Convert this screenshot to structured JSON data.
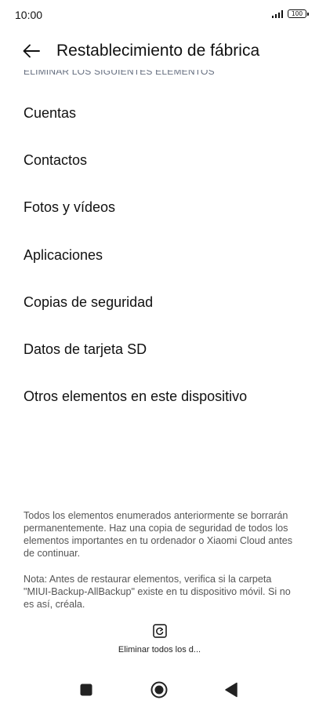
{
  "status_bar": {
    "time": "10:00",
    "battery": "100",
    "icons": [
      "signal-icon",
      "battery-icon"
    ]
  },
  "header": {
    "title": "Restablecimiento de fábrica",
    "back_icon": "arrow-left-icon"
  },
  "section_label": "ELIMINAR LOS SIGUIENTES ELEMENTOS",
  "items": [
    {
      "label": "Cuentas"
    },
    {
      "label": "Contactos"
    },
    {
      "label": "Fotos y vídeos"
    },
    {
      "label": "Aplicaciones"
    },
    {
      "label": "Copias de seguridad"
    },
    {
      "label": "Datos de tarjeta SD"
    },
    {
      "label": "Otros elementos en este dispositivo"
    }
  ],
  "info": {
    "warning": "Todos los elementos enumerados anteriormente se borrarán permanentemente. Haz una copia de seguridad de todos los elementos importantes en tu ordenador o Xiaomi Cloud antes de continuar.",
    "note": "Nota: Antes de restaurar elementos, verifica si la carpeta \"MIUI-Backup-AllBackup\" existe en tu dispositivo móvil. Si no es así, créala."
  },
  "action": {
    "label": "Eliminar todos los d...",
    "icon": "reset-icon"
  },
  "nav": {
    "icons": [
      "recent-apps-icon",
      "home-icon",
      "back-triangle-icon"
    ]
  }
}
